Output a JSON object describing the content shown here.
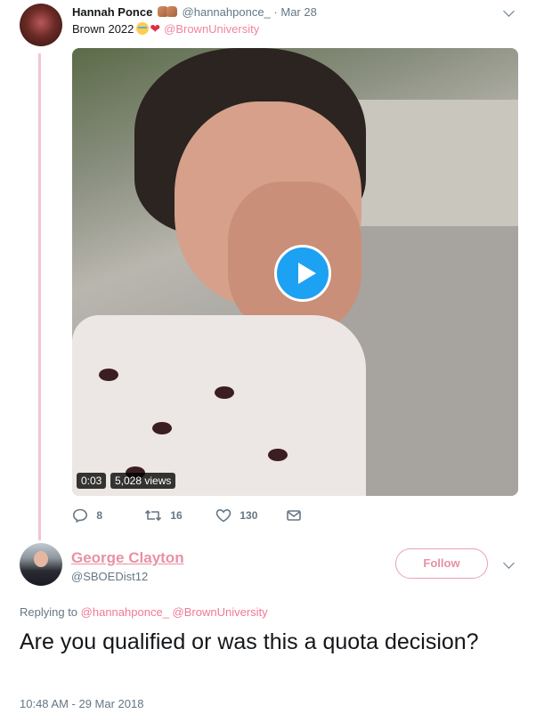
{
  "tweet1": {
    "name": "Hannah Ponce",
    "handle": "@hannahponce_",
    "separator": "·",
    "date": "Mar 28",
    "text": "Brown 2022",
    "mention": "@BrownUniversity",
    "video": {
      "duration": "0:03",
      "views": "5,028 views"
    },
    "actions": {
      "replies": "8",
      "retweets": "16",
      "likes": "130"
    }
  },
  "reply": {
    "name": "George Clayton",
    "handle": "@SBOEDist12",
    "follow_label": "Follow",
    "replying_prefix": "Replying to",
    "replying_to": [
      "@hannahponce_",
      "@BrownUniversity"
    ],
    "text": "Are you qualified or was this a quota decision?",
    "timestamp": "10:48 AM - 29 Mar 2018"
  },
  "colors": {
    "accent_blue": "#1da1f2",
    "pink_mention": "#e81c4f",
    "muted": "#657786"
  },
  "icons": [
    "chevron-down-icon",
    "praise-hands-emoji",
    "crying-face-emoji",
    "red-heart-emoji",
    "play-icon",
    "reply-icon",
    "retweet-icon",
    "like-icon",
    "direct-message-icon"
  ]
}
